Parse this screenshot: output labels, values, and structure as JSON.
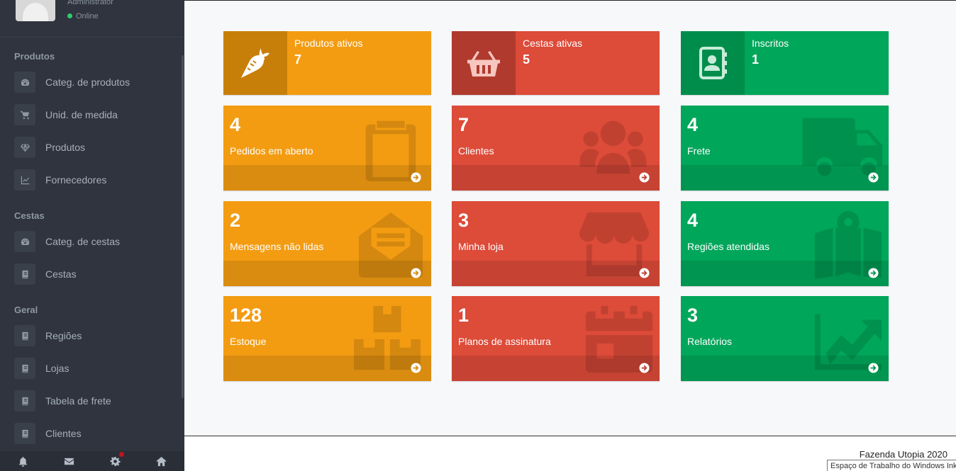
{
  "user": {
    "name": "Administrator",
    "status": "Online"
  },
  "sidebar": {
    "sections": [
      {
        "title": "Produtos",
        "items": [
          {
            "label": "Categ. de produtos",
            "icon": "dashboard-icon"
          },
          {
            "label": "Unid. de medida",
            "icon": "cart-icon"
          },
          {
            "label": "Produtos",
            "icon": "diamond-icon"
          },
          {
            "label": "Fornecedores",
            "icon": "chart-icon"
          }
        ]
      },
      {
        "title": "Cestas",
        "items": [
          {
            "label": "Categ. de cestas",
            "icon": "dashboard-icon"
          },
          {
            "label": "Cestas",
            "icon": "book-icon"
          }
        ]
      },
      {
        "title": "Geral",
        "items": [
          {
            "label": "Regiões",
            "icon": "book-icon"
          },
          {
            "label": "Lojas",
            "icon": "book-icon"
          },
          {
            "label": "Tabela de frete",
            "icon": "book-icon"
          },
          {
            "label": "Clientes",
            "icon": "book-icon"
          }
        ]
      }
    ],
    "footer_icons": [
      "bell-icon",
      "envelope-icon",
      "gear-icon",
      "home-icon"
    ]
  },
  "info_boxes": [
    {
      "label": "Produtos ativos",
      "value": "7",
      "icon": "carrot-icon",
      "color": "#f39c12"
    },
    {
      "label": "Cestas ativas",
      "value": "5",
      "icon": "basket-icon",
      "color": "#dd4b39"
    },
    {
      "label": "Inscritos",
      "value": "1",
      "icon": "address-book-icon",
      "color": "#00a65a"
    }
  ],
  "small_boxes": [
    {
      "number": "4",
      "label": "Pedidos em aberto",
      "icon": "clipboard-icon",
      "color": "#f39c12"
    },
    {
      "number": "7",
      "label": "Clientes",
      "icon": "users-icon",
      "color": "#dd4b39"
    },
    {
      "number": "4",
      "label": "Frete",
      "icon": "truck-icon",
      "color": "#00a65a"
    },
    {
      "number": "2",
      "label": "Mensagens não lidas",
      "icon": "envelope-open-icon",
      "color": "#f39c12"
    },
    {
      "number": "3",
      "label": "Minha loja",
      "icon": "store-icon",
      "color": "#dd4b39"
    },
    {
      "number": "4",
      "label": "Regiões atendidas",
      "icon": "map-icon",
      "color": "#00a65a"
    },
    {
      "number": "128",
      "label": "Estoque",
      "icon": "boxes-icon",
      "color": "#f39c12"
    },
    {
      "number": "1",
      "label": "Planos de assinatura",
      "icon": "calendar-icon",
      "color": "#dd4b39"
    },
    {
      "number": "3",
      "label": "Relatórios",
      "icon": "chart-line-icon",
      "color": "#00a65a"
    }
  ],
  "footer": {
    "copyright": "Fazenda Utopia 2020",
    "tooltip": "Espaço de Trabalho do Windows Ink"
  }
}
